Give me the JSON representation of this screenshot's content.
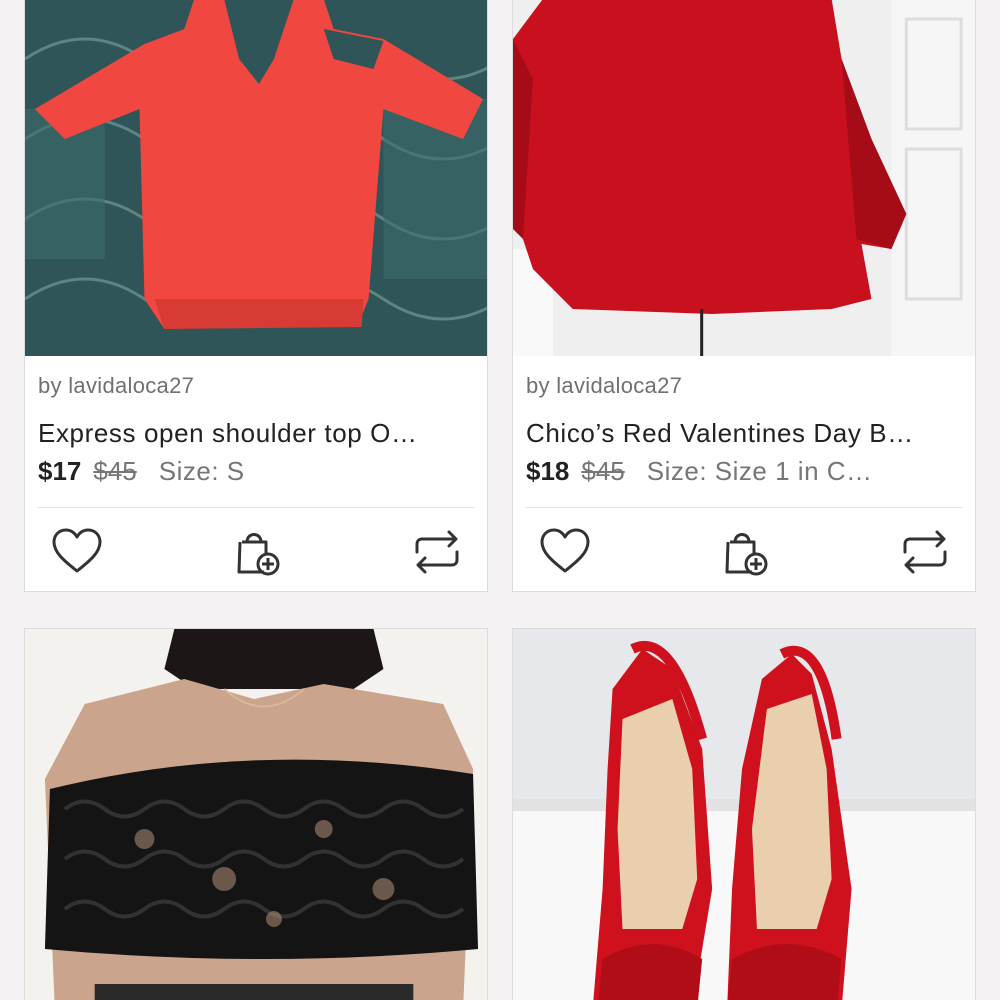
{
  "listings": [
    {
      "seller": "by lavidaloca27",
      "title": "Express open shoulder top O…",
      "price": "$17",
      "original_price": "$45",
      "size": "Size: S",
      "image_subject": "red open-shoulder top"
    },
    {
      "seller": "by lavidaloca27",
      "title": "Chico’s Red Valentines Day B…",
      "price": "$18",
      "original_price": "$45",
      "size": "Size: Size 1 in C…",
      "image_subject": "red bell-sleeve dress"
    },
    {
      "image_subject": "black lace off-shoulder crop top"
    },
    {
      "image_subject": "red slingback heels"
    }
  ],
  "icons": {
    "like": "heart-icon",
    "bundle": "shopping-bag-plus-icon",
    "share": "share-arrows-icon"
  },
  "colors": {
    "text_primary": "#222222",
    "text_secondary": "#707070",
    "background": "#f4f2f2"
  }
}
